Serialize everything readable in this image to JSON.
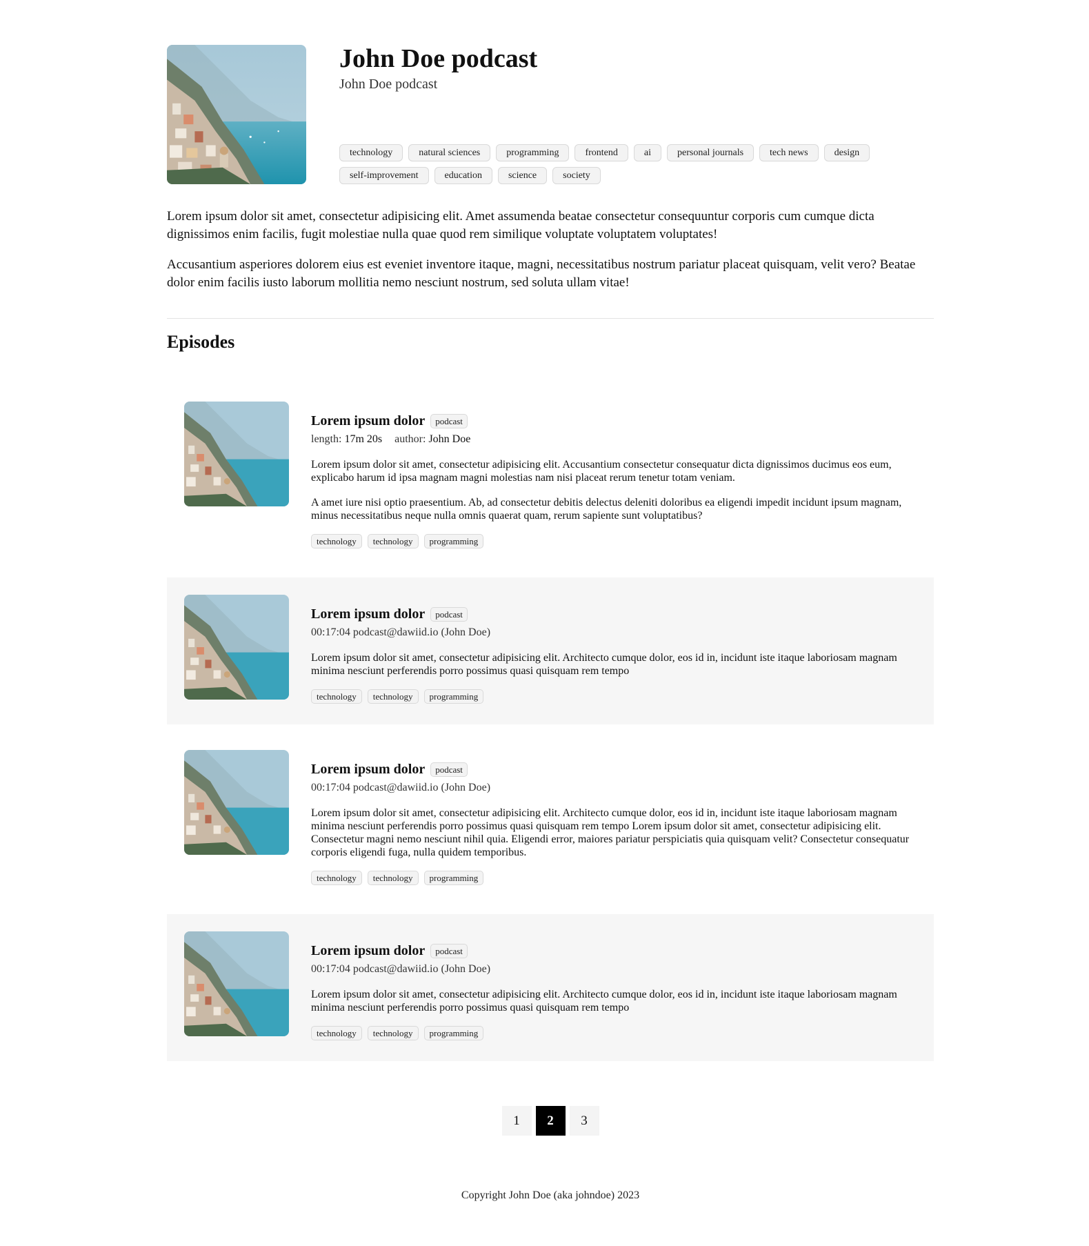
{
  "podcast": {
    "title": "John Doe podcast",
    "subtitle": "John Doe podcast",
    "tags": [
      "technology",
      "natural sciences",
      "programming",
      "frontend",
      "ai",
      "personal journals",
      "tech news",
      "design",
      "self-improvement",
      "education",
      "science",
      "society"
    ],
    "description": [
      "Lorem ipsum dolor sit amet, consectetur adipisicing elit. Amet assumenda beatae consectetur consequuntur corporis cum cumque dicta dignissimos enim facilis, fugit molestiae nulla quae quod rem similique voluptate voluptatem voluptates!",
      "Accusantium asperiores dolorem eius est eveniet inventore itaque, magni, necessitatibus nostrum pariatur placeat quisquam, velit vero? Beatae dolor enim facilis iusto laborum mollitia nemo nesciunt nostrum, sed soluta ullam vitae!"
    ]
  },
  "episodes_heading": "Episodes",
  "episodes": [
    {
      "title": "Lorem ipsum dolor",
      "badge": "podcast",
      "length_label": "length:",
      "length": "17m 20s",
      "author_label": "author:",
      "author": "John Doe",
      "description": [
        "Lorem ipsum dolor sit amet, consectetur adipisicing elit. Accusantium consectetur consequatur dicta dignissimos ducimus eos eum, explicabo harum id ipsa magnam magni molestias nam nisi placeat rerum tenetur totam veniam.",
        "A amet iure nisi optio praesentium. Ab, ad consectetur debitis delectus deleniti doloribus ea eligendi impedit incidunt ipsum magnam, minus necessitatibus neque nulla omnis quaerat quam, rerum sapiente sunt voluptatibus?"
      ],
      "tags": [
        "technology",
        "technology",
        "programming"
      ]
    },
    {
      "title": "Lorem ipsum dolor",
      "badge": "podcast",
      "meta": "00:17:04 podcast@dawiid.io (John Doe)",
      "description": [
        "Lorem ipsum dolor sit amet, consectetur adipisicing elit. Architecto cumque dolor, eos id in, incidunt iste itaque laboriosam magnam minima nesciunt perferendis porro possimus quasi quisquam rem tempo"
      ],
      "tags": [
        "technology",
        "technology",
        "programming"
      ]
    },
    {
      "title": "Lorem ipsum dolor",
      "badge": "podcast",
      "meta": "00:17:04 podcast@dawiid.io (John Doe)",
      "description": [
        "Lorem ipsum dolor sit amet, consectetur adipisicing elit. Architecto cumque dolor, eos id in, incidunt iste itaque laboriosam magnam minima nesciunt perferendis porro possimus quasi quisquam rem tempo Lorem ipsum dolor sit amet, consectetur adipisicing elit. Consectetur magni nemo nesciunt nihil quia. Eligendi error, maiores pariatur perspiciatis quia quisquam velit? Consectetur consequatur corporis eligendi fuga, nulla quidem temporibus."
      ],
      "tags": [
        "technology",
        "technology",
        "programming"
      ]
    },
    {
      "title": "Lorem ipsum dolor",
      "badge": "podcast",
      "meta": "00:17:04 podcast@dawiid.io (John Doe)",
      "description": [
        "Lorem ipsum dolor sit amet, consectetur adipisicing elit. Architecto cumque dolor, eos id in, incidunt iste itaque laboriosam magnam minima nesciunt perferendis porro possimus quasi quisquam rem tempo"
      ],
      "tags": [
        "technology",
        "technology",
        "programming"
      ]
    }
  ],
  "pagination": {
    "pages": [
      "1",
      "2",
      "3"
    ],
    "current": "2"
  },
  "footer": "Copyright John Doe (aka johndoe) 2023",
  "colors": {
    "active_page_bg": "#000000",
    "shaded_row_bg": "#f6f6f6",
    "sea": "#2f9bb3",
    "sky": "#9cc4d6"
  }
}
